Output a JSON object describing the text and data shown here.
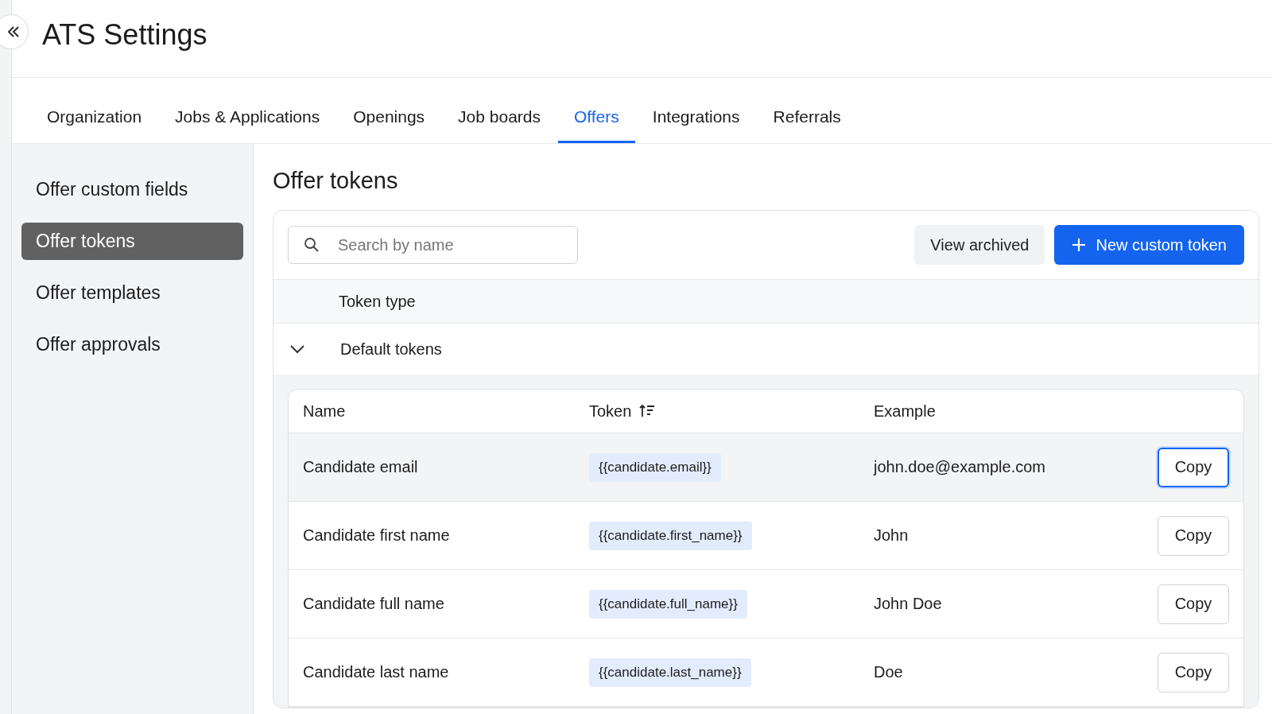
{
  "page": {
    "title": "ATS Settings"
  },
  "tabs": [
    {
      "label": "Organization",
      "selected": false
    },
    {
      "label": "Jobs & Applications",
      "selected": false
    },
    {
      "label": "Openings",
      "selected": false
    },
    {
      "label": "Job boards",
      "selected": false
    },
    {
      "label": "Offers",
      "selected": true
    },
    {
      "label": "Integrations",
      "selected": false
    },
    {
      "label": "Referrals",
      "selected": false
    }
  ],
  "sidebar": {
    "items": [
      {
        "label": "Offer custom fields",
        "selected": false
      },
      {
        "label": "Offer tokens",
        "selected": true
      },
      {
        "label": "Offer templates",
        "selected": false
      },
      {
        "label": "Offer approvals",
        "selected": false
      }
    ]
  },
  "content": {
    "heading": "Offer tokens",
    "search": {
      "placeholder": "Search by name"
    },
    "buttons": {
      "view_archived": "View archived",
      "new_token": "New custom token"
    },
    "group_header": "Token type",
    "group": {
      "label": "Default tokens",
      "expanded": true
    },
    "table": {
      "columns": [
        "Name",
        "Token",
        "Example"
      ],
      "rows": [
        {
          "name": "Candidate email",
          "token": "{{candidate.email}}",
          "example": "john.doe@example.com",
          "action": "Copy",
          "highlighted": true,
          "focused": true
        },
        {
          "name": "Candidate first name",
          "token": "{{candidate.first_name}}",
          "example": "John",
          "action": "Copy",
          "highlighted": false,
          "focused": false
        },
        {
          "name": "Candidate full name",
          "token": "{{candidate.full_name}}",
          "example": "John Doe",
          "action": "Copy",
          "highlighted": false,
          "focused": false
        },
        {
          "name": "Candidate last name",
          "token": "{{candidate.last_name}}",
          "example": "Doe",
          "action": "Copy",
          "highlighted": false,
          "focused": false
        }
      ]
    }
  }
}
